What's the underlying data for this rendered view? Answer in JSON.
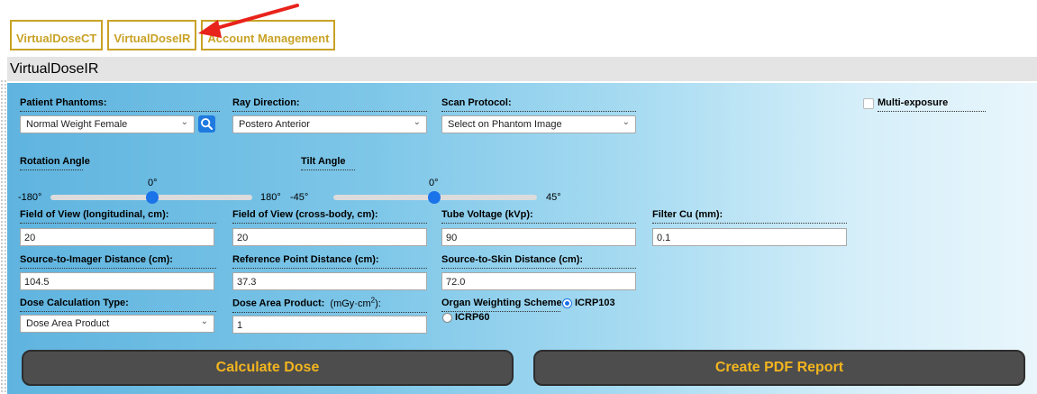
{
  "nav": {
    "tabs": [
      {
        "label": "VirtualDoseCT"
      },
      {
        "label": "VirtualDoseIR"
      },
      {
        "label": "Account Management"
      }
    ]
  },
  "header": {
    "title": "VirtualDoseIR"
  },
  "form": {
    "patient_phantoms": {
      "label": "Patient Phantoms:",
      "value": "Normal Weight Female"
    },
    "ray_direction": {
      "label": "Ray Direction:",
      "value": "Postero Anterior"
    },
    "scan_protocol": {
      "label": "Scan Protocol:",
      "value": "Select on Phantom Image"
    },
    "multi_exposure": {
      "label": "Multi-exposure",
      "checked": false
    },
    "rotation_angle": {
      "label": "Rotation Angle",
      "value": "0°",
      "min": "-180°",
      "max": "180°"
    },
    "tilt_angle": {
      "label": "Tilt Angle",
      "value": "0°",
      "min": "-45°",
      "max": "45°"
    },
    "fov_longitudinal": {
      "label": "Field of View (longitudinal, cm):",
      "value": "20"
    },
    "fov_cross_body": {
      "label": "Field of View (cross-body, cm):",
      "value": "20"
    },
    "tube_voltage": {
      "label": "Tube Voltage (kVp):",
      "value": "90"
    },
    "filter_cu": {
      "label": "Filter Cu (mm):",
      "value": "0.1"
    },
    "source_imager_distance": {
      "label": "Source-to-Imager Distance (cm):",
      "value": "104.5"
    },
    "reference_point_distance": {
      "label": "Reference Point Distance (cm):",
      "value": "37.3"
    },
    "source_skin_distance": {
      "label": "Source-to-Skin Distance (cm):",
      "value": "72.0"
    },
    "dose_calc_type": {
      "label": "Dose Calculation Type:",
      "value": "Dose Area Product"
    },
    "dose_area_product": {
      "label": "Dose Area Product:",
      "unit_prefix": "(mGy·cm",
      "unit_exp": "2",
      "unit_suffix": "):",
      "value": "1"
    },
    "organ_weighting": {
      "label": "Organ Weighting Scheme",
      "options": [
        "ICRP103",
        "ICRP60"
      ],
      "selected": "ICRP103"
    }
  },
  "actions": {
    "calculate": "Calculate Dose",
    "pdf": "Create PDF Report"
  },
  "colors": {
    "tab_gold": "#c9a226",
    "button_text": "#f2b51e",
    "button_bg": "#4d4d4d",
    "accent_blue": "#1a73e8",
    "arrow_red": "#e8231b"
  }
}
